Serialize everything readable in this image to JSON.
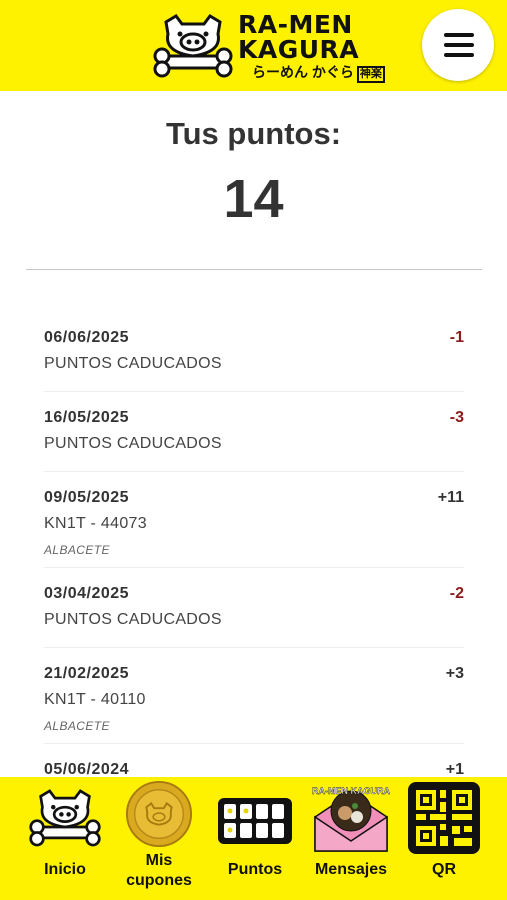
{
  "header": {
    "logo_line1": "RA-MEN",
    "logo_line2": "KAGURA",
    "logo_jp": "らーめん かぐら",
    "logo_kanji": "神楽"
  },
  "points": {
    "title": "Tus puntos:",
    "value": "14"
  },
  "history": [
    {
      "date": "06/06/2025",
      "amount": "-1",
      "description": "PUNTOS CADUCADOS",
      "place": ""
    },
    {
      "date": "16/05/2025",
      "amount": "-3",
      "description": "PUNTOS CADUCADOS",
      "place": ""
    },
    {
      "date": "09/05/2025",
      "amount": "+11",
      "description": "KN1T - 44073",
      "place": "ALBACETE"
    },
    {
      "date": "03/04/2025",
      "amount": "-2",
      "description": "PUNTOS CADUCADOS",
      "place": ""
    },
    {
      "date": "21/02/2025",
      "amount": "+3",
      "description": "KN1T - 40110",
      "place": "ALBACETE"
    },
    {
      "date": "05/06/2024",
      "amount": "+1",
      "description": "",
      "place": ""
    }
  ],
  "nav": {
    "inicio": "Inicio",
    "cupones_line1": "Mis",
    "cupones_line2": "cupones",
    "puntos": "Puntos",
    "mensajes": "Mensajes",
    "qr": "QR",
    "envelope_text": "RA-MEN KAGURA"
  },
  "colors": {
    "brand_yellow": "#fff200",
    "negative": "#8b1a1a"
  }
}
